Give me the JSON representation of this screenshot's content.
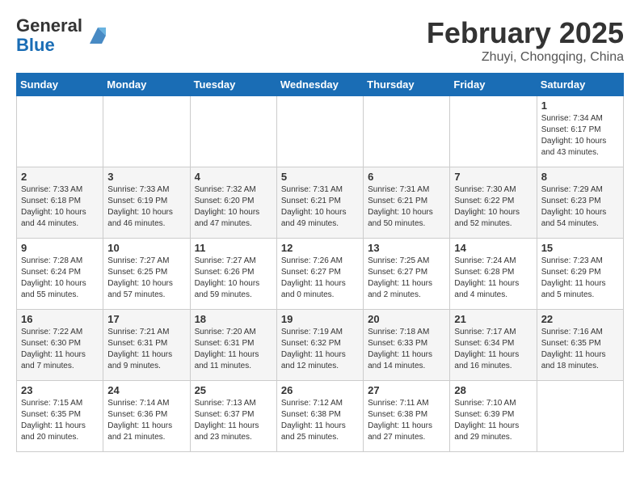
{
  "header": {
    "logo_general": "General",
    "logo_blue": "Blue",
    "month_title": "February 2025",
    "location": "Zhuyi, Chongqing, China"
  },
  "weekdays": [
    "Sunday",
    "Monday",
    "Tuesday",
    "Wednesday",
    "Thursday",
    "Friday",
    "Saturday"
  ],
  "weeks": [
    [
      null,
      null,
      null,
      null,
      null,
      null,
      {
        "day": "1",
        "sunrise": "Sunrise: 7:34 AM",
        "sunset": "Sunset: 6:17 PM",
        "daylight": "Daylight: 10 hours and 43 minutes."
      }
    ],
    [
      {
        "day": "2",
        "sunrise": "Sunrise: 7:33 AM",
        "sunset": "Sunset: 6:18 PM",
        "daylight": "Daylight: 10 hours and 44 minutes."
      },
      {
        "day": "3",
        "sunrise": "Sunrise: 7:33 AM",
        "sunset": "Sunset: 6:19 PM",
        "daylight": "Daylight: 10 hours and 46 minutes."
      },
      {
        "day": "4",
        "sunrise": "Sunrise: 7:32 AM",
        "sunset": "Sunset: 6:20 PM",
        "daylight": "Daylight: 10 hours and 47 minutes."
      },
      {
        "day": "5",
        "sunrise": "Sunrise: 7:31 AM",
        "sunset": "Sunset: 6:21 PM",
        "daylight": "Daylight: 10 hours and 49 minutes."
      },
      {
        "day": "6",
        "sunrise": "Sunrise: 7:31 AM",
        "sunset": "Sunset: 6:21 PM",
        "daylight": "Daylight: 10 hours and 50 minutes."
      },
      {
        "day": "7",
        "sunrise": "Sunrise: 7:30 AM",
        "sunset": "Sunset: 6:22 PM",
        "daylight": "Daylight: 10 hours and 52 minutes."
      },
      {
        "day": "8",
        "sunrise": "Sunrise: 7:29 AM",
        "sunset": "Sunset: 6:23 PM",
        "daylight": "Daylight: 10 hours and 54 minutes."
      }
    ],
    [
      {
        "day": "9",
        "sunrise": "Sunrise: 7:28 AM",
        "sunset": "Sunset: 6:24 PM",
        "daylight": "Daylight: 10 hours and 55 minutes."
      },
      {
        "day": "10",
        "sunrise": "Sunrise: 7:27 AM",
        "sunset": "Sunset: 6:25 PM",
        "daylight": "Daylight: 10 hours and 57 minutes."
      },
      {
        "day": "11",
        "sunrise": "Sunrise: 7:27 AM",
        "sunset": "Sunset: 6:26 PM",
        "daylight": "Daylight: 10 hours and 59 minutes."
      },
      {
        "day": "12",
        "sunrise": "Sunrise: 7:26 AM",
        "sunset": "Sunset: 6:27 PM",
        "daylight": "Daylight: 11 hours and 0 minutes."
      },
      {
        "day": "13",
        "sunrise": "Sunrise: 7:25 AM",
        "sunset": "Sunset: 6:27 PM",
        "daylight": "Daylight: 11 hours and 2 minutes."
      },
      {
        "day": "14",
        "sunrise": "Sunrise: 7:24 AM",
        "sunset": "Sunset: 6:28 PM",
        "daylight": "Daylight: 11 hours and 4 minutes."
      },
      {
        "day": "15",
        "sunrise": "Sunrise: 7:23 AM",
        "sunset": "Sunset: 6:29 PM",
        "daylight": "Daylight: 11 hours and 5 minutes."
      }
    ],
    [
      {
        "day": "16",
        "sunrise": "Sunrise: 7:22 AM",
        "sunset": "Sunset: 6:30 PM",
        "daylight": "Daylight: 11 hours and 7 minutes."
      },
      {
        "day": "17",
        "sunrise": "Sunrise: 7:21 AM",
        "sunset": "Sunset: 6:31 PM",
        "daylight": "Daylight: 11 hours and 9 minutes."
      },
      {
        "day": "18",
        "sunrise": "Sunrise: 7:20 AM",
        "sunset": "Sunset: 6:31 PM",
        "daylight": "Daylight: 11 hours and 11 minutes."
      },
      {
        "day": "19",
        "sunrise": "Sunrise: 7:19 AM",
        "sunset": "Sunset: 6:32 PM",
        "daylight": "Daylight: 11 hours and 12 minutes."
      },
      {
        "day": "20",
        "sunrise": "Sunrise: 7:18 AM",
        "sunset": "Sunset: 6:33 PM",
        "daylight": "Daylight: 11 hours and 14 minutes."
      },
      {
        "day": "21",
        "sunrise": "Sunrise: 7:17 AM",
        "sunset": "Sunset: 6:34 PM",
        "daylight": "Daylight: 11 hours and 16 minutes."
      },
      {
        "day": "22",
        "sunrise": "Sunrise: 7:16 AM",
        "sunset": "Sunset: 6:35 PM",
        "daylight": "Daylight: 11 hours and 18 minutes."
      }
    ],
    [
      {
        "day": "23",
        "sunrise": "Sunrise: 7:15 AM",
        "sunset": "Sunset: 6:35 PM",
        "daylight": "Daylight: 11 hours and 20 minutes."
      },
      {
        "day": "24",
        "sunrise": "Sunrise: 7:14 AM",
        "sunset": "Sunset: 6:36 PM",
        "daylight": "Daylight: 11 hours and 21 minutes."
      },
      {
        "day": "25",
        "sunrise": "Sunrise: 7:13 AM",
        "sunset": "Sunset: 6:37 PM",
        "daylight": "Daylight: 11 hours and 23 minutes."
      },
      {
        "day": "26",
        "sunrise": "Sunrise: 7:12 AM",
        "sunset": "Sunset: 6:38 PM",
        "daylight": "Daylight: 11 hours and 25 minutes."
      },
      {
        "day": "27",
        "sunrise": "Sunrise: 7:11 AM",
        "sunset": "Sunset: 6:38 PM",
        "daylight": "Daylight: 11 hours and 27 minutes."
      },
      {
        "day": "28",
        "sunrise": "Sunrise: 7:10 AM",
        "sunset": "Sunset: 6:39 PM",
        "daylight": "Daylight: 11 hours and 29 minutes."
      },
      null
    ]
  ]
}
